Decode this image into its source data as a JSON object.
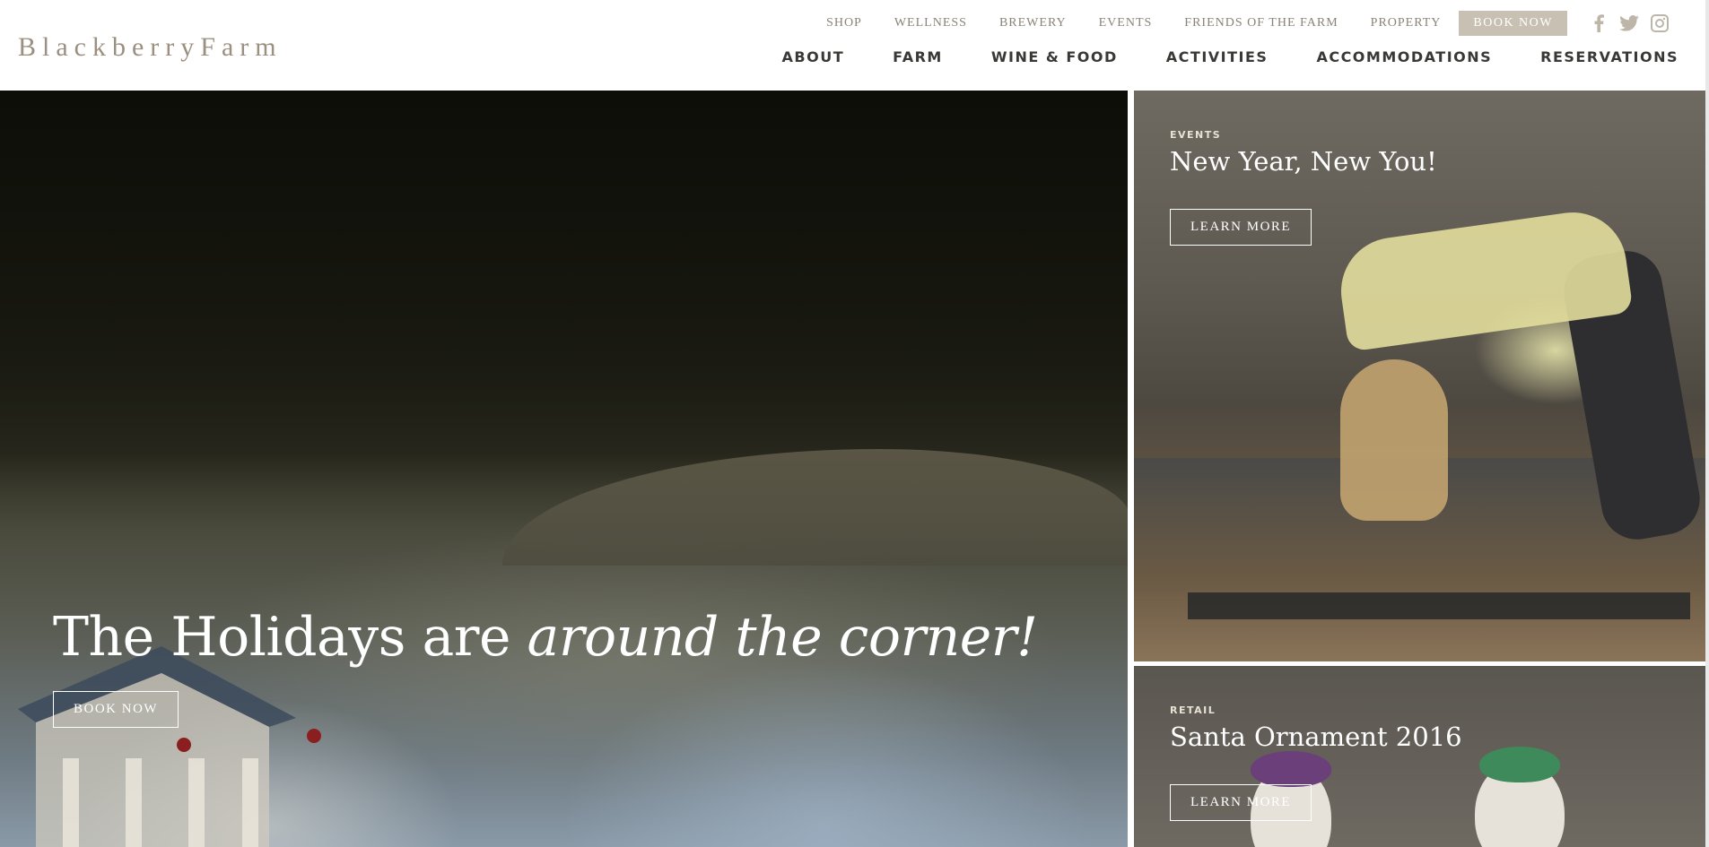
{
  "brand": {
    "logo_text": "BlackberryFarm"
  },
  "utility_nav": {
    "links": [
      "SHOP",
      "WELLNESS",
      "BREWERY",
      "EVENTS",
      "FRIENDS OF THE FARM",
      "PROPERTY"
    ],
    "book_now": "BOOK NOW",
    "social_icons": [
      "facebook-icon",
      "twitter-icon",
      "instagram-icon"
    ]
  },
  "main_nav": {
    "links": [
      "ABOUT",
      "FARM",
      "WINE & FOOD",
      "ACTIVITIES",
      "ACCOMMODATIONS",
      "RESERVATIONS"
    ]
  },
  "hero": {
    "title_plain": "The Holidays are ",
    "title_italic": "around the corner!",
    "button": "BOOK NOW"
  },
  "cards": [
    {
      "label": "EVENTS",
      "title": "New Year, New You!",
      "button": "LEARN MORE"
    },
    {
      "label": "RETAIL",
      "title": "Santa Ornament 2016",
      "button": "LEARN MORE"
    }
  ],
  "colors": {
    "logo": "#9b9080",
    "book_now_bg": "#c8c0b2",
    "nav_text": "#3a3835",
    "util_text": "#8a8478"
  }
}
